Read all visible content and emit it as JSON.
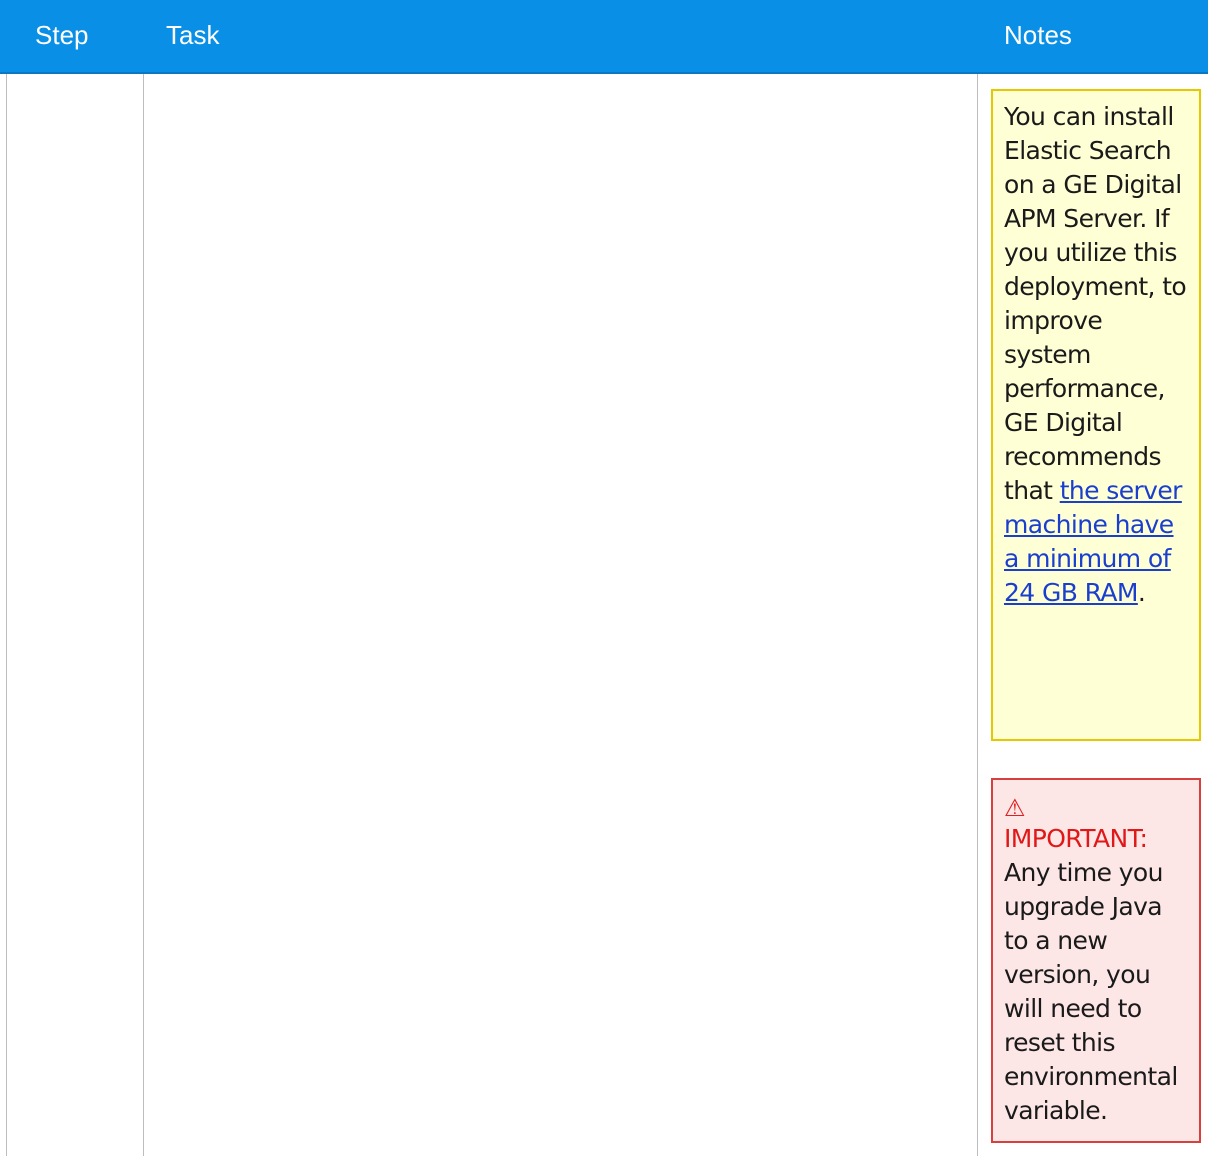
{
  "header": {
    "step": "Step",
    "task": "Task",
    "notes": "Notes"
  },
  "info_note": {
    "text_before": "You can install Elastic Search on a GE Digital APM Server. If you utilize this deployment, to improve system performance, GE Digital recommends that ",
    "link_text": "the server machine have a minimum of 24 GB RAM",
    "text_after": "."
  },
  "important_note": {
    "icon": "warning-icon",
    "label": "IMPORTANT:",
    "text": "Any time you upgrade Java to a new version, you will need to reset this environmental variable."
  },
  "colors": {
    "header_bg": "#0a8fe6",
    "info_bg": "#ffffd6",
    "info_border": "#e6c800",
    "important_bg": "#fde6e6",
    "important_border": "#d84040",
    "important_text": "#e01818",
    "link": "#1a3fcf"
  }
}
